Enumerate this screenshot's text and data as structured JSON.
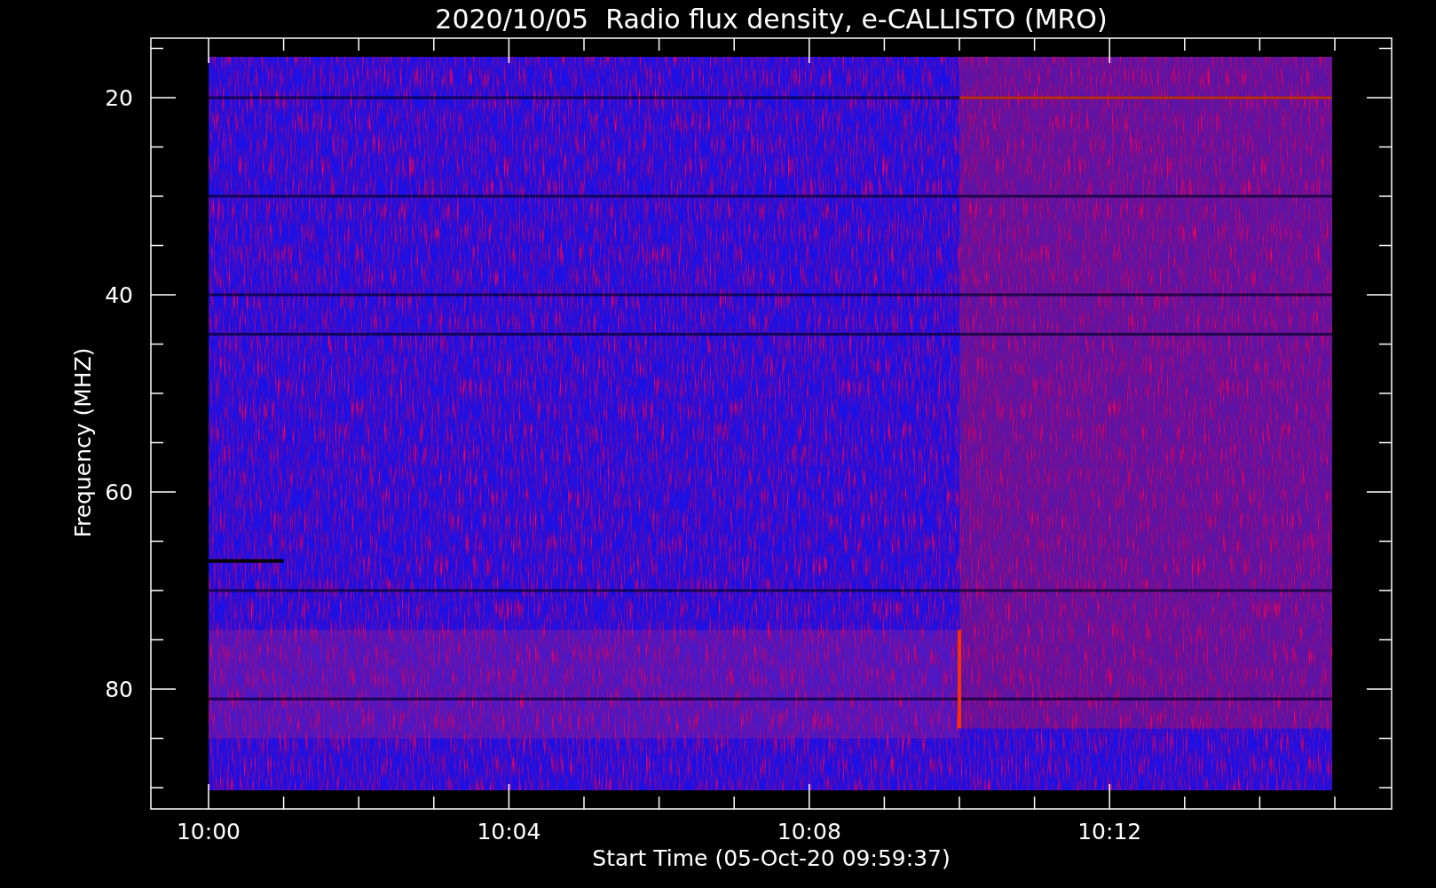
{
  "title": "2020/10/05  Radio flux density, e-CALLISTO (MRO)",
  "y_axis": {
    "label": "Frequency (MHZ)",
    "ticks": [
      "20",
      "40",
      "60",
      "80"
    ]
  },
  "x_axis": {
    "label": "Start Time (05-Oct-20 09:59:37)",
    "ticks": [
      "10:00",
      "10:04",
      "10:08",
      "10:12"
    ]
  }
}
